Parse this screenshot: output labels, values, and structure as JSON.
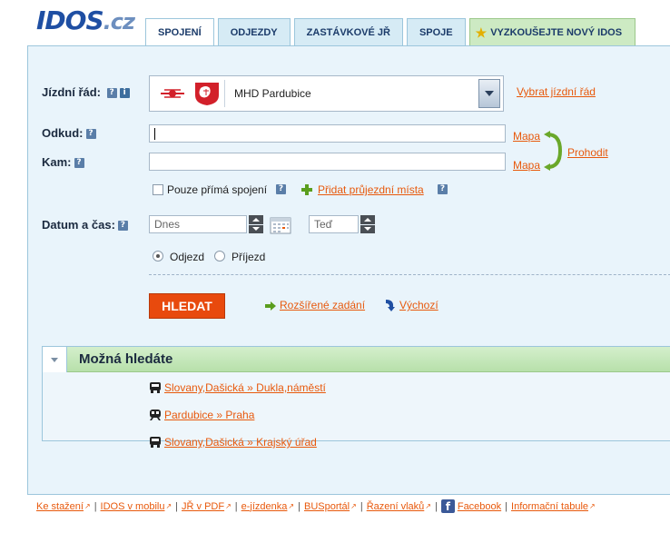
{
  "logo": {
    "main": "IDOS",
    "suffix": ".cz"
  },
  "tabs": [
    {
      "label": "SPOJENÍ",
      "active": true
    },
    {
      "label": "ODJEZDY"
    },
    {
      "label": "ZASTÁVKOVÉ JŘ"
    },
    {
      "label": "SPOJE"
    },
    {
      "label": "VYZKOUŠEJTE NOVÝ IDOS",
      "icon": "star-icon"
    }
  ],
  "form": {
    "jizdni_rad_label": "Jízdní řád:",
    "timetable_value": "MHD Pardubice",
    "vybrat_link": "Vybrat jízdní řád",
    "odkud_label": "Odkud:",
    "kam_label": "Kam:",
    "odkud_value": "",
    "kam_value": "",
    "mapa_link": "Mapa",
    "prohodit_link": "Prohodit",
    "prime_label": "Pouze přímá spojení",
    "pridat_link": "Přidat průjezdní místa",
    "datum_label": "Datum a čas:",
    "date_placeholder": "Dnes",
    "time_placeholder": "Teď",
    "odjezd_label": "Odjezd",
    "prijezd_label": "Příjezd",
    "search_button": "HLEDAT",
    "rozsirene_link": "Rozšířené zadání",
    "vychozi_link": "Výchozí"
  },
  "suggestions": {
    "title": "Možná hledáte",
    "items": [
      {
        "label": "Slovany,Dašická » Dukla,náměstí",
        "icon": "bus-icon"
      },
      {
        "label": "Pardubice » Praha",
        "icon": "train-icon"
      },
      {
        "label": "Slovany,Dašická » Krajský úřad",
        "icon": "bus-icon"
      }
    ]
  },
  "footer": {
    "links": [
      "Ke stažení",
      "IDOS v mobilu",
      "JŘ v PDF",
      "e-jízdenka",
      "BUSportál",
      "Řazení vlaků",
      "Facebook",
      "Informační tabule"
    ]
  },
  "colors": {
    "accent": "#e8590c",
    "panel": "#e9f4fb",
    "brand": "#1f4fa3",
    "search": "#e84a0d"
  }
}
